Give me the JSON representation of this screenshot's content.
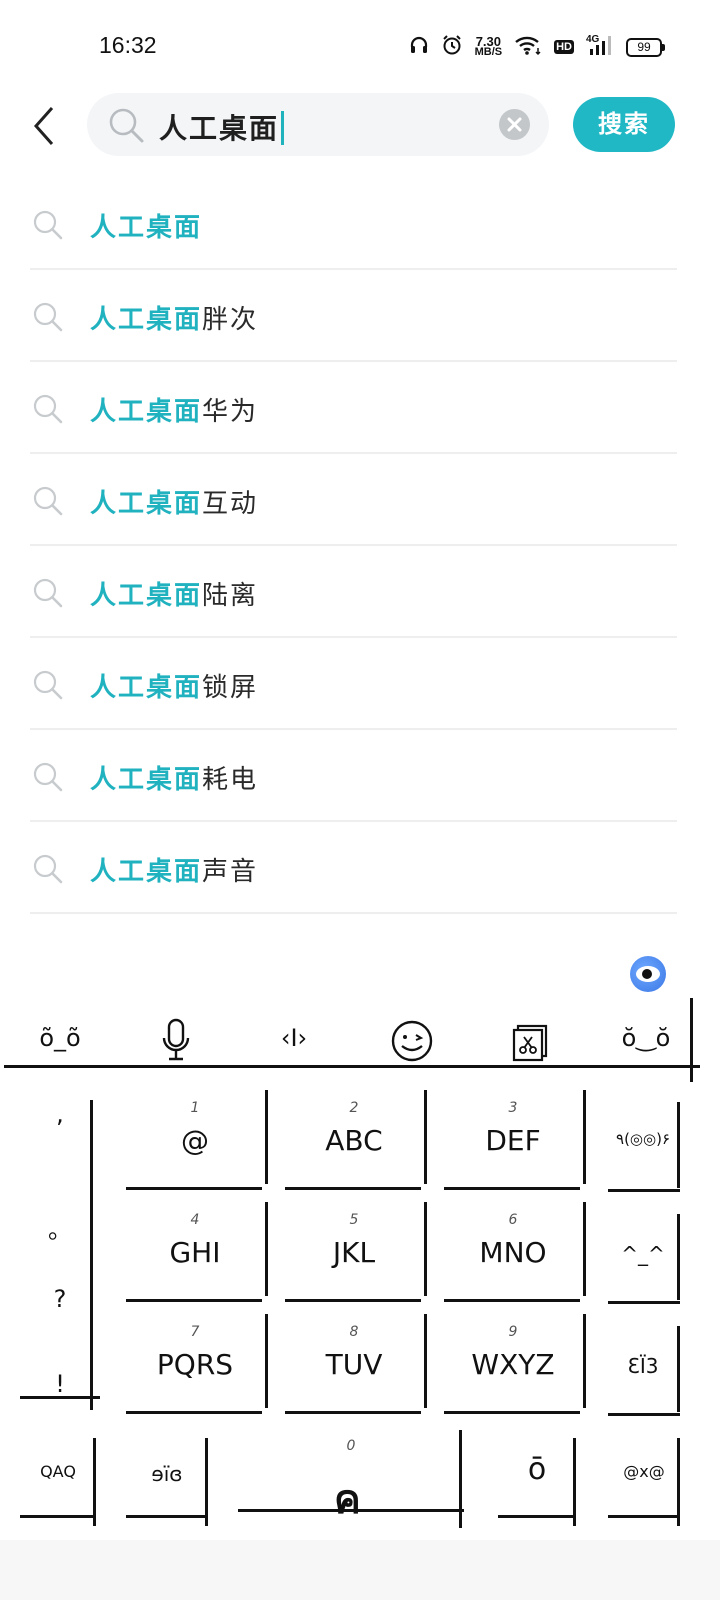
{
  "status_bar": {
    "time": "16:32",
    "net_speed_value": "7.30",
    "net_speed_unit": "MB/S",
    "hd_label": "HD",
    "network": "4G",
    "battery": "99"
  },
  "search": {
    "query": "人工桌面",
    "button_label": "搜索"
  },
  "suggestions": [
    {
      "highlight": "人工桌面",
      "rest": ""
    },
    {
      "highlight": "人工桌面",
      "rest": "胖次"
    },
    {
      "highlight": "人工桌面",
      "rest": "华为"
    },
    {
      "highlight": "人工桌面",
      "rest": "互动"
    },
    {
      "highlight": "人工桌面",
      "rest": "陆离"
    },
    {
      "highlight": "人工桌面",
      "rest": "锁屏"
    },
    {
      "highlight": "人工桌面",
      "rest": "耗电"
    },
    {
      "highlight": "人工桌面",
      "rest": "声音"
    }
  ],
  "keyboard": {
    "toolbar": {
      "left_emoticon": "õ_õ",
      "cursor": "‹I›",
      "right_emoticon": "ŏ‿ŏ"
    },
    "punctuation": [
      ",",
      "。",
      "?",
      "!"
    ],
    "keys": [
      {
        "num": "1",
        "letters": "@"
      },
      {
        "num": "2",
        "letters": "ABC"
      },
      {
        "num": "3",
        "letters": "DEF"
      },
      {
        "num": "4",
        "letters": "GHI"
      },
      {
        "num": "5",
        "letters": "JKL"
      },
      {
        "num": "6",
        "letters": "MNO"
      },
      {
        "num": "7",
        "letters": "PQRS"
      },
      {
        "num": "8",
        "letters": "TUV"
      },
      {
        "num": "9",
        "letters": "WXYZ"
      }
    ],
    "side_emoticons": [
      "٩(◎◎)۶",
      "^_^",
      "ƐÏ3"
    ],
    "bottom_row": {
      "left": "QAQ",
      "second": "ɘïɞ",
      "zero_num": "0",
      "space_glyph": "ค",
      "fourth": "ō",
      "right": "@x@"
    }
  }
}
